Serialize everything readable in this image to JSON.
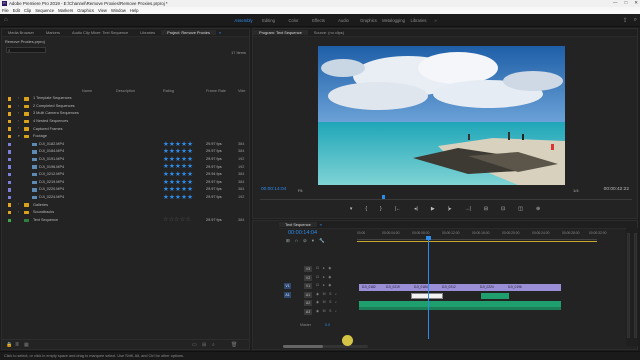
{
  "window": {
    "title": "Adobe Premiere Pro 2019 - E:\\Channel\\Remove Proxies\\Remove Proxies.prproj *",
    "icon_label": "Pr",
    "controls": [
      "—",
      "□",
      "✕"
    ]
  },
  "menubar": [
    "File",
    "Edit",
    "Clip",
    "Sequence",
    "Markers",
    "Graphics",
    "View",
    "Window",
    "Help"
  ],
  "workspaces": [
    "Assembly",
    "Editing",
    "Color",
    "Effects",
    "Audio",
    "Graphics",
    "Metalogging",
    "Libraries"
  ],
  "workspaces_active": "Assembly",
  "left_tabs": [
    "Media Browser",
    "Markers",
    "Audio Clip Mixer: Text Sequence",
    "Libraries",
    "Project: Remove Proxies"
  ],
  "left_tabs_menu": "≡",
  "project": {
    "path": "Remove Proxies.prproj",
    "search_placeholder": "",
    "item_count": "17 Items",
    "columns": [
      "Name",
      "Description",
      "Rating",
      "Frame Rate",
      "Vide"
    ],
    "rows": [
      {
        "name": "1 Template Sequences",
        "type": "folder",
        "chip": "#e0a523",
        "rating": "",
        "fps": "",
        "vd": ""
      },
      {
        "name": "2 Completed Sequences",
        "type": "folder",
        "chip": "#e0a523",
        "rating": "",
        "fps": "",
        "vd": ""
      },
      {
        "name": "3 Multi Camera Sequences",
        "type": "folder",
        "chip": "#e0a523",
        "rating": "",
        "fps": "",
        "vd": ""
      },
      {
        "name": "4 Nested Sequences",
        "type": "folder",
        "chip": "#e0a523",
        "rating": "",
        "fps": "",
        "vd": ""
      },
      {
        "name": "Captured Frames",
        "type": "folder",
        "chip": "#e0a523",
        "rating": "",
        "fps": "",
        "vd": ""
      },
      {
        "name": "Footage",
        "type": "folder-open",
        "chip": "#e0a523",
        "rating": "",
        "fps": "",
        "vd": ""
      },
      {
        "name": "DJI_0182.MP4",
        "type": "file",
        "chip": "#7b7fd9",
        "rating": "★★★★★",
        "rating_value": 5,
        "fps": "29.97 fps",
        "vd": "384"
      },
      {
        "name": "DJI_0184.MP4",
        "type": "file",
        "chip": "#7b7fd9",
        "rating": "★★★★★",
        "rating_value": 5,
        "fps": "29.97 fps",
        "vd": "384"
      },
      {
        "name": "DJI_0191.MP4",
        "type": "file",
        "chip": "#7b7fd9",
        "rating": "★★★★★",
        "rating_value": 5,
        "fps": "29.97 fps",
        "vd": "192"
      },
      {
        "name": "DJI_0196.MP4",
        "type": "file",
        "chip": "#7b7fd9",
        "rating": "★★★★★",
        "rating_value": 5,
        "fps": "29.97 fps",
        "vd": "192"
      },
      {
        "name": "DJI_0212.MP4",
        "type": "file",
        "chip": "#7b7fd9",
        "rating": "★★★★★",
        "rating_value": 5,
        "fps": "29.94 fps",
        "vd": "384"
      },
      {
        "name": "DJI_0219.MP4",
        "type": "file",
        "chip": "#7b7fd9",
        "rating": "★★★★★",
        "rating_value": 5,
        "fps": "29.97 fps",
        "vd": "384"
      },
      {
        "name": "DJI_0220.MP4",
        "type": "file",
        "chip": "#7b7fd9",
        "rating": "★★★★★",
        "rating_value": 5,
        "fps": "29.97 fps",
        "vd": "384"
      },
      {
        "name": "DJI_0224.MP4",
        "type": "file",
        "chip": "#7b7fd9",
        "rating": "★★★★★",
        "rating_value": 5,
        "fps": "29.97 fps",
        "vd": "192"
      },
      {
        "name": "Galleries",
        "type": "folder",
        "chip": "#e0a523",
        "rating": "",
        "fps": "",
        "vd": ""
      },
      {
        "name": "Soundtracks",
        "type": "folder",
        "chip": "#e0a523",
        "rating": "",
        "fps": "",
        "vd": ""
      },
      {
        "name": "Text Sequence",
        "type": "sequence",
        "chip": "#3fa64e",
        "rating": "☆☆☆☆☆",
        "rating_value": 0,
        "fps": "29.97 fps",
        "vd": "384"
      }
    ]
  },
  "monitor": {
    "tabs": [
      "Program: Text Sequence",
      "Source: (no clips)"
    ],
    "timecode": "00:00:14:04",
    "fit": "Fit",
    "resolution": "1/4",
    "duration": "00:00:42:22",
    "transport": [
      "▾",
      "{",
      "}",
      "|←",
      "◂|",
      "▶",
      "|▸",
      "→|",
      "⊟",
      "⊡",
      "◫",
      "⊕"
    ]
  },
  "timeline": {
    "tab": "Text Sequence",
    "timecode": "00:00:14:04",
    "ruler": [
      "00:00",
      "00:00:04:00",
      "00:00:08:00",
      "00:00:12:00",
      "00:00:16:00",
      "00:00:20:00",
      "00:00:24:00",
      "00:00:28:00",
      "00:00:32:00"
    ],
    "video_tracks": [
      "V3",
      "V2",
      "V1"
    ],
    "audio_tracks": [
      "A1",
      "A2",
      "A3"
    ],
    "track_icons": "⊡ ● ◉",
    "audio_icons": "◉ M S ♪",
    "target_v": "V1",
    "target_a": "A1",
    "master_label": "Master",
    "master_value": "0.0",
    "clips": [
      "DJI_0182",
      "DJI_0219",
      "DJI_0184",
      "DJI_0212",
      "DJI_0224",
      "DJI_0196",
      "DJI_0220"
    ]
  },
  "status": "Click to select, or click in empty space and drag to marquee select. Use Shift, Alt, and Ctrl for other options.",
  "colors": {
    "accent": "#2d8ceb",
    "folder": "#d9a21b",
    "clip_video": "#9a8ed6",
    "clip_audio": "#1f9e6e"
  }
}
